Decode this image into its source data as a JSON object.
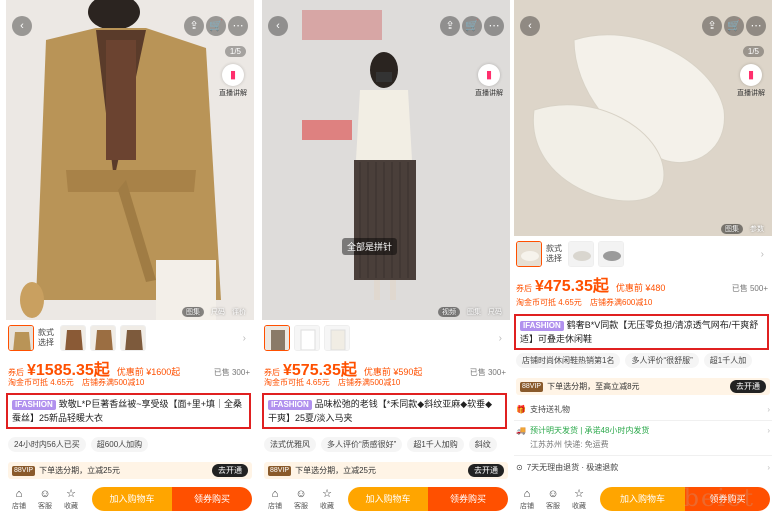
{
  "panels": [
    {
      "pager": "1/5",
      "live_label": "直播讲解",
      "view_tabs": [
        "图集",
        "尺码",
        "评价"
      ],
      "sku_label": "款式\n选择",
      "price_label": "券后",
      "price_value": "¥1585.35起",
      "price_before": "¥1600起",
      "price_before_label": "优惠前",
      "sold": "已售 300+",
      "promos": [
        "淘金币可抵 4.65元",
        "店铺券满500减10"
      ],
      "tag": "IFASHION",
      "title": "致敬L*P巨著香丝被~享受级【面+里+填｜全桑蚕丝】25新品轻暖大衣",
      "chips": [
        "24小时内56人已买",
        "超600人加购"
      ],
      "vip_badge": "88VIP",
      "vip_text": "下单选分期，立减25元",
      "vip_button": "去开通",
      "bottom_icons": [
        {
          "icon": "store-icon",
          "label": "店铺"
        },
        {
          "icon": "service-icon",
          "label": "客服"
        },
        {
          "icon": "star-icon",
          "label": "收藏"
        }
      ],
      "cta_cart": "加入购物车",
      "cta_buy": "领券购买"
    },
    {
      "pager": "",
      "live_label": "直播讲解",
      "view_tabs": [
        "视频",
        "图集",
        "尺码"
      ],
      "overlay": "全部是拼针",
      "sku_label": "",
      "price_label": "券后",
      "price_value": "¥575.35起",
      "price_before": "¥590起",
      "price_before_label": "优惠前",
      "sold": "已售 300+",
      "promos": [
        "淘金币可抵 4.65元",
        "店铺券满500减10"
      ],
      "tag": "IFASHION",
      "title": "品味松弛的老钱【*禾同款◆斜纹亚麻◆软垂◆干爽】25夏/淡入马夹",
      "chips": [
        "法式优雅风",
        "多人评价“质感很好”",
        "超1千人加购",
        "斜纹"
      ],
      "vip_badge": "88VIP",
      "vip_text": "下单选分期，立减25元",
      "vip_button": "去开通",
      "bottom_icons": [
        {
          "icon": "store-icon",
          "label": "店铺"
        },
        {
          "icon": "service-icon",
          "label": "客服"
        },
        {
          "icon": "star-icon",
          "label": "收藏"
        }
      ],
      "cta_cart": "加入购物车",
      "cta_buy": "领券购买"
    },
    {
      "pager": "1/5",
      "live_label": "直播讲解",
      "view_tabs": [
        "图集",
        "参数"
      ],
      "sku_label": "款式\n选择",
      "price_label": "券后",
      "price_value": "¥475.35起",
      "price_before": "¥480",
      "price_before_label": "优惠前",
      "sold": "已售 500+",
      "promos": [
        "淘金币可抵 4.65元",
        "店铺券满600减10"
      ],
      "tag": "IFASHION",
      "title": "鹤奢B*V同款【无压零负担/清凉透气网布/干爽舒适】可叠走休闲鞋",
      "chips": [
        "店铺时尚休闲鞋热销第1名",
        "多人评价“很舒服”",
        "超1千人加"
      ],
      "vip_badge": "88VIP",
      "vip_text": "下单选分期，至高立减8元",
      "vip_button": "去开通",
      "list": [
        {
          "text": "支持送礼物"
        },
        {
          "text": "预计明天发货 | 承诺48小时内发货",
          "sub": "江苏苏州  快递: 免运费"
        },
        {
          "text": "7天无理由退货 · 极速退款"
        }
      ],
      "bottom_icons": [
        {
          "icon": "store-icon",
          "label": "店铺"
        },
        {
          "icon": "service-icon",
          "label": "客服"
        },
        {
          "icon": "star-icon",
          "label": "收藏"
        }
      ],
      "cta_cart": "加入购物车",
      "cta_buy": "领券购买"
    }
  ],
  "watermark": "beiot",
  "colors": {
    "accent": "#ff5000",
    "cart": "#ffa500",
    "highlight": "#e02020",
    "tag": "#b191ee"
  }
}
